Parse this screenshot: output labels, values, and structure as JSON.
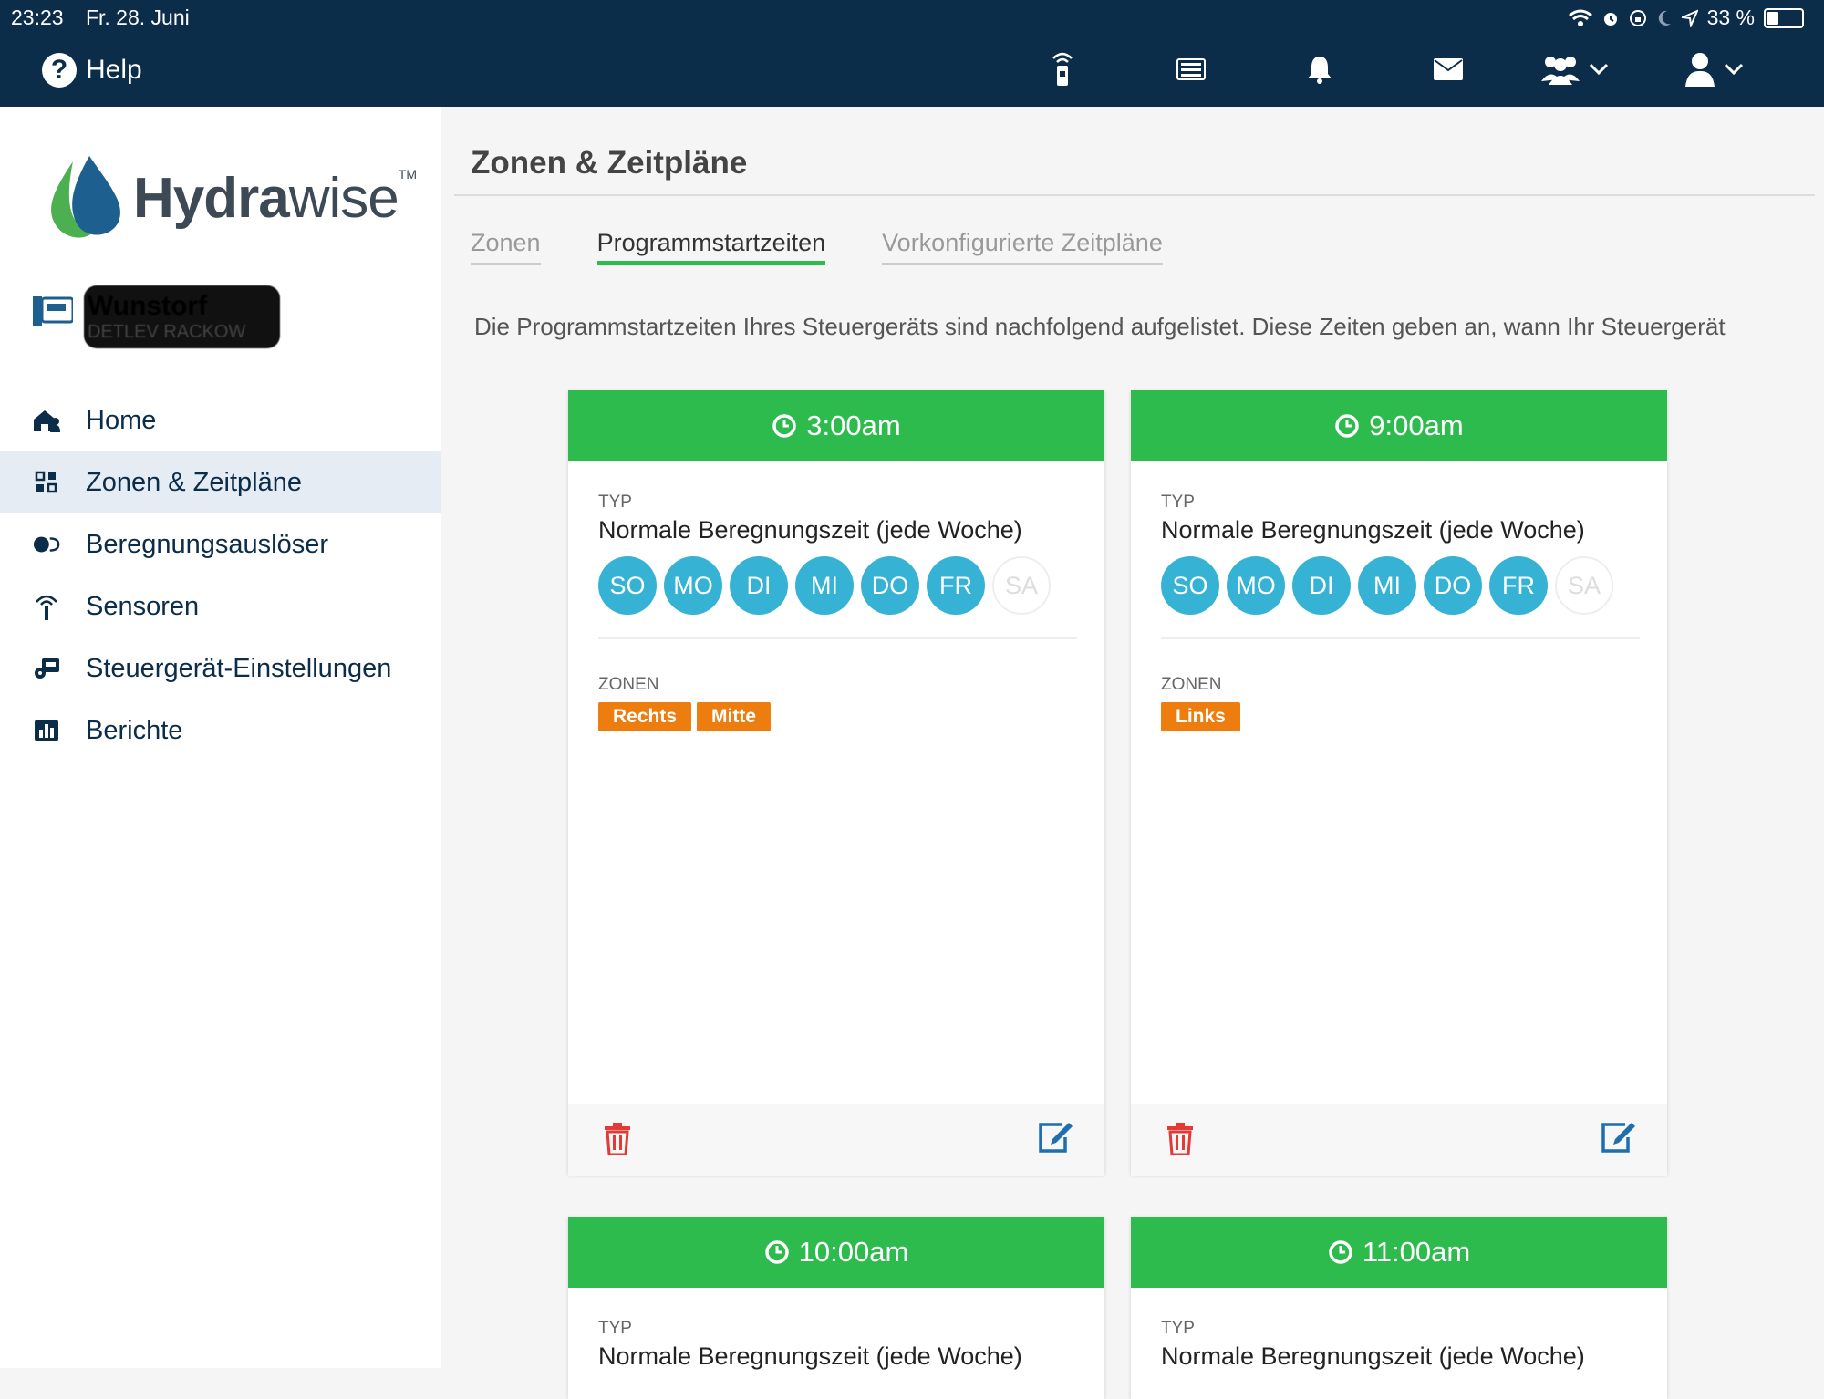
{
  "status_bar": {
    "time": "23:23",
    "date": "Fr. 28. Juni",
    "battery": "33 %",
    "battery_level": 0.33
  },
  "topbar": {
    "help_label": "Help"
  },
  "sidebar": {
    "logo_part1": "Hydra",
    "logo_part2": "wise",
    "logo_tm": "TM",
    "controller_name": "Wunstorf",
    "controller_owner": "DETLEV RACKOW",
    "menu": [
      {
        "label": "Home"
      },
      {
        "label": "Zonen & Zeitpläne"
      },
      {
        "label": "Beregnungsauslöser"
      },
      {
        "label": "Sensoren"
      },
      {
        "label": "Steuergerät-Einstellungen"
      },
      {
        "label": "Berichte"
      }
    ]
  },
  "main": {
    "title": "Zonen & Zeitpläne",
    "tabs": [
      {
        "label": "Zonen"
      },
      {
        "label": "Programmstartzeiten"
      },
      {
        "label": "Vorkonfigurierte Zeitpläne"
      }
    ],
    "description": "Die Programmstartzeiten Ihres Steuergeräts sind nachfolgend aufgelistet. Diese Zeiten geben an, wann Ihr Steuergerät",
    "type_label": "TYP",
    "zones_label": "ZONEN",
    "days": [
      "SO",
      "MO",
      "DI",
      "MI",
      "DO",
      "FR",
      "SA"
    ],
    "cards": [
      {
        "time": "3:00am",
        "type": "Normale Beregnungszeit (jede Woche)",
        "zones": [
          "Rechts",
          "Mitte"
        ]
      },
      {
        "time": "9:00am",
        "type": "Normale Beregnungszeit (jede Woche)",
        "zones": [
          "Links"
        ]
      },
      {
        "time": "10:00am",
        "type": "Normale Beregnungszeit (jede Woche)"
      },
      {
        "time": "11:00am",
        "type": "Normale Beregnungszeit (jede Woche)"
      }
    ]
  }
}
